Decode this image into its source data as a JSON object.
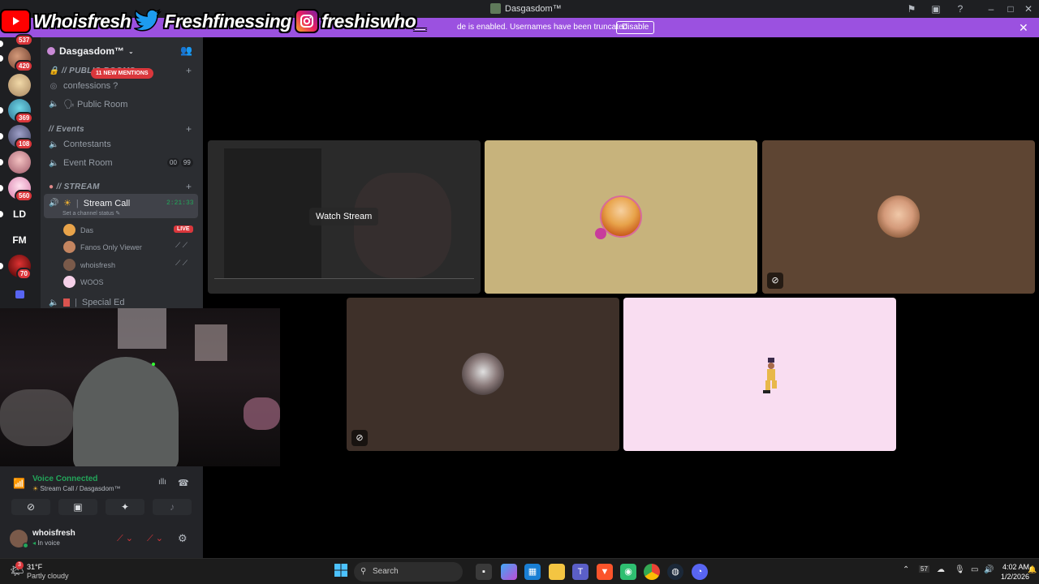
{
  "window": {
    "title": "Dasgasdom™"
  },
  "banner": {
    "message": "de is enabled. Usernames have been truncated.",
    "disable_label": "Disable"
  },
  "overlay": {
    "youtube": "Whoisfresh",
    "twitter": "Freshfinessing",
    "instagram": "freshiswho_"
  },
  "servers": [
    {
      "badge": "537"
    },
    {
      "badge": "420"
    },
    {
      "badge": ""
    },
    {
      "badge": "369"
    },
    {
      "badge": "108"
    },
    {
      "badge": ""
    },
    {
      "badge": "560"
    },
    {
      "text": "LD"
    },
    {
      "text": "FM"
    },
    {
      "badge": "70"
    }
  ],
  "sidebar": {
    "server_name": "Dasgasdom™",
    "mentions": "11 NEW MENTIONS",
    "categories": {
      "public": "// PUBLIC ROOMS",
      "events": "// Events",
      "stream": "// STREAM"
    },
    "channels": {
      "confessions": "confessions ?",
      "public_room": "🗣 Public Room",
      "contestants": "Contestants",
      "event_room": "Event Room",
      "event_room_count_a": "00",
      "event_room_count_b": "99",
      "stream_call": "Stream Call",
      "stream_call_timer": "2:21:33",
      "stream_call_status": "Set a channel status",
      "special_ed": "Special Ed"
    },
    "members": [
      {
        "name": "Das",
        "live": "LIVE"
      },
      {
        "name": "Fanos Only Viewer"
      },
      {
        "name": "whoisfresh"
      },
      {
        "name": "WOOS"
      }
    ]
  },
  "panel": {
    "voice_connected": "Voice Connected",
    "voice_location": "Stream Call / Dasgasdom™",
    "username": "whoisfresh",
    "user_status": "In voice"
  },
  "stage": {
    "watch_stream": "Watch Stream",
    "colors": {
      "tile_stream": "#2a2a2a",
      "tile_tan": "#c7b37c",
      "tile_brown": "#5e4533",
      "tile_darkbrown": "#3e3029",
      "tile_pink": "#f9ddf1"
    }
  },
  "taskbar": {
    "temperature": "31°F",
    "weather": "Partly cloudy",
    "search_placeholder": "Search",
    "time": "4:02 AM",
    "date": "1/2/2026",
    "weather_badge": "3"
  }
}
